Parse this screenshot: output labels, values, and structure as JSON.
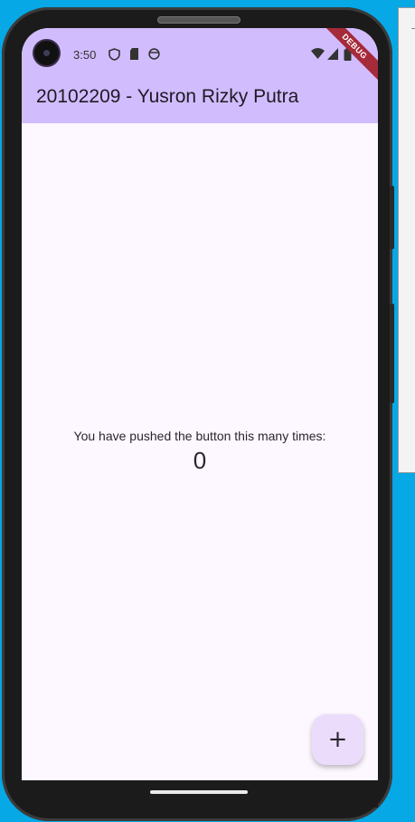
{
  "status_bar": {
    "time": "3:50",
    "icons": [
      "shield-icon",
      "sd-card-icon",
      "face-icon",
      "wifi-icon",
      "signal-icon",
      "battery-icon"
    ]
  },
  "debug_banner": "DEBUG",
  "app_bar": {
    "title": "20102209 - Yusron Rizky Putra",
    "color": "#d1bcfe"
  },
  "body": {
    "message": "You have pushed the button this many times:",
    "counter": "0"
  },
  "fab": {
    "icon": "add-icon",
    "label": "+"
  }
}
